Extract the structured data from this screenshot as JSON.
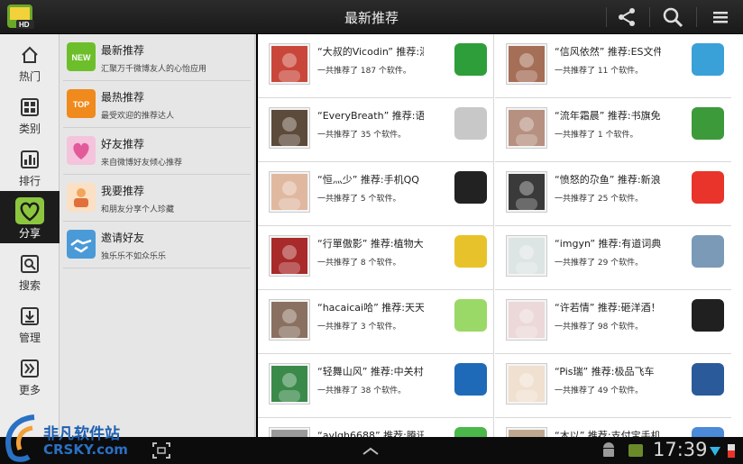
{
  "header": {
    "title": "最新推荐",
    "app_icon": "hd-app-icon"
  },
  "nav": [
    {
      "label": "热门",
      "icon": "home-icon"
    },
    {
      "label": "类别",
      "icon": "grid-icon"
    },
    {
      "label": "排行",
      "icon": "ranking-icon"
    },
    {
      "label": "分享",
      "icon": "heart-icon",
      "active": true
    },
    {
      "label": "搜索",
      "icon": "search-icon"
    },
    {
      "label": "管理",
      "icon": "download-icon"
    },
    {
      "label": "更多",
      "icon": "more-icon"
    }
  ],
  "menu": [
    {
      "title": "最新推荐",
      "sub": "汇聚万千微博友人的心怡应用",
      "badge": "NEW",
      "color": "#6cbf2a"
    },
    {
      "title": "最热推荐",
      "sub": "最受欢迎的推荐达人",
      "badge": "TOP",
      "color": "#f08a1c"
    },
    {
      "title": "好友推荐",
      "sub": "来自微博好友倾心推荐",
      "badge": "",
      "color": "#e25a9a"
    },
    {
      "title": "我要推荐",
      "sub": "和朋友分享个人珍藏",
      "badge": "",
      "color": "#f2a65a"
    },
    {
      "title": "邀请好友",
      "sub": "独乐乐不如众乐乐",
      "badge": "",
      "color": "#4a9ad8"
    }
  ],
  "cells": [
    {
      "title": "“大叔的Vicodin” 推荐:湯",
      "count": "一共推荐了 187 个软件。",
      "avatar": "#c9473a",
      "app": "#2e9e3a"
    },
    {
      "title": "“信风依然” 推荐:ES文件",
      "count": "一共推荐了 11 个软件。",
      "avatar": "#a56e57",
      "app": "#3aa0d8"
    },
    {
      "title": "“EveryBreath” 推荐:语",
      "count": "一共推荐了 35 个软件。",
      "avatar": "#5c4a3a",
      "app": "#c8c8c8"
    },
    {
      "title": "“流年霜晨” 推荐:书旗免",
      "count": "一共推荐了 1 个软件。",
      "avatar": "#b69080",
      "app": "#3d9a3a"
    },
    {
      "title": "“恒灬少” 推荐:手机QQ",
      "count": "一共推荐了 5 个软件。",
      "avatar": "#e0b8a0",
      "app": "#222222"
    },
    {
      "title": "“愤怒的尕鱼” 推荐:新浪",
      "count": "一共推荐了 25 个软件。",
      "avatar": "#3a3a3a",
      "app": "#e8342a"
    },
    {
      "title": "“行單傲影” 推荐:植物大",
      "count": "一共推荐了 8 个软件。",
      "avatar": "#a82a2a",
      "app": "#e8c22a"
    },
    {
      "title": "“imgyn” 推荐:有道词典",
      "count": "一共推荐了 29 个软件。",
      "avatar": "#dde4e4",
      "app": "#7a9ab8"
    },
    {
      "title": "“hacaicai哈” 推荐:天天",
      "count": "一共推荐了 3 个软件。",
      "avatar": "#8a7060",
      "app": "#9ad868"
    },
    {
      "title": "“许若情” 推荐:砸洋酒！",
      "count": "一共推荐了 98 个软件。",
      "avatar": "#ecd8d8",
      "app": "#202020"
    },
    {
      "title": "“轻舞山风” 推荐:中关村",
      "count": "一共推荐了 38 个软件。",
      "avatar": "#3a8a4a",
      "app": "#1e6ab8"
    },
    {
      "title": "“Pis瑞” 推荐:极品飞车",
      "count": "一共推荐了 49 个软件。",
      "avatar": "#f0e0d0",
      "app": "#2a5a9a"
    },
    {
      "title": "“aylgh6688” 推荐:腾讯",
      "count": "",
      "avatar": "#9a9a9a",
      "app": "#4ab84a"
    },
    {
      "title": "“木以” 推荐:支付宝手机",
      "count": "",
      "avatar": "#c0a890",
      "app": "#4a8ad8"
    }
  ],
  "system": {
    "clock": "17:39"
  },
  "watermark": {
    "text": "非凡软件站",
    "url": "CRSKY.com"
  }
}
